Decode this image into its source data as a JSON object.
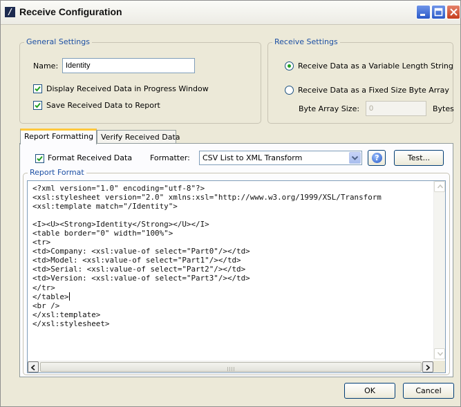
{
  "window": {
    "title": "Receive Configuration"
  },
  "colors": {
    "group_legend": "#1c4fa3",
    "tab_highlight": "#ffc83c",
    "radio_dot": "#21a121"
  },
  "icons": {
    "app": "app-logo-icon",
    "minimize": "minimize-icon",
    "maximize": "maximize-icon",
    "close": "close-icon",
    "help": "help-icon"
  },
  "general_settings": {
    "legend": "General Settings",
    "name_label": "Name:",
    "name_value": "Identity",
    "display_received_label": "Display Received Data in Progress Window",
    "display_received_checked": true,
    "save_received_label": "Save Received Data to Report",
    "save_received_checked": true
  },
  "receive_settings": {
    "legend": "Receive Settings",
    "variable_length_label": "Receive Data as a Variable Length String",
    "fixed_size_label": "Receive Data as a Fixed Size Byte Array",
    "selected": "variable_length",
    "byte_array_size_label": "Byte Array Size:",
    "byte_array_size_value": "0",
    "bytes_unit": "Bytes"
  },
  "tabs": [
    {
      "label": "Report Formatting",
      "active": true
    },
    {
      "label": "Verify Received Data",
      "active": false
    }
  ],
  "report_formatting": {
    "format_received_label": "Format Received Data",
    "format_received_checked": true,
    "formatter_label": "Formatter:",
    "formatter_value": "CSV List to XML Transform",
    "help_glyph": "?",
    "test_button": "Test...",
    "report_format_legend": "Report Format",
    "code_before_caret": "<?xml version=\"1.0\" encoding=\"utf-8\"?>\n<xsl:stylesheet version=\"2.0\" xmlns:xsl=\"http://www.w3.org/1999/XSL/Transform\n<xsl:template match=\"/Identity\">\n\n<I><U><Strong>Identity</Strong></U></I>\n<table border=\"0\" width=\"100%\">\n<tr>\n<td>Company: <xsl:value-of select=\"Part0\"/></td>\n<td>Model: <xsl:value-of select=\"Part1\"/></td>\n<td>Serial: <xsl:value-of select=\"Part2\"/></td>\n<td>Version: <xsl:value-of select=\"Part3\"/></td>\n</tr>\n</table>",
    "code_after_caret": "\n<br />\n</xsl:template>\n</xsl:stylesheet>"
  },
  "footer": {
    "ok_button": "OK",
    "cancel_button": "Cancel"
  }
}
